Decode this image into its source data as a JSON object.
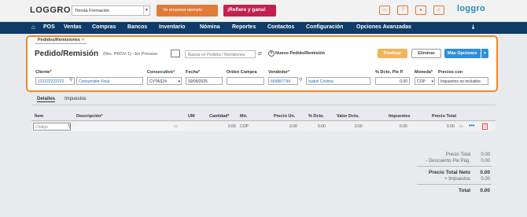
{
  "header": {
    "app_name": "LOGGRO",
    "company": "Tienda Formación",
    "example_button": "Ve empresa ejemplo",
    "refer_button": "¡Refiere y gana!",
    "brand_mark": "loggro"
  },
  "nav": {
    "items": [
      "POS",
      "Ventas",
      "Compras",
      "Bancos",
      "Inventario",
      "Nómina",
      "Reportes",
      "Contactos",
      "Configuración",
      "Opciones Avanzadas"
    ]
  },
  "panel": {
    "tab_label": "Pedidos/Remisiones",
    "title": "Pedido/Remisión",
    "subtitle": "(Nro. PROV-1) - En Proceso",
    "search_placeholder": "Buscar en Pedidos / Remisiones",
    "new_label": "Nuevo Pedido/Remisión",
    "finalize_label": "Finalizar",
    "delete_label": "Eliminar",
    "more_label": "Más Opciones",
    "fields": {
      "cliente_label": "Cliente",
      "cliente_id": "222222222222",
      "cliente_name": "Consumidor Final",
      "consecutivo_label": "Consecutivo",
      "consecutivo_value": "CVTAS24",
      "fecha_label": "Fecha",
      "fecha_value": "30/09/2025",
      "orden_label": "Orden Compra",
      "orden_value": "",
      "vendedor_label": "Vendedor",
      "vendedor_id": "669887794",
      "vendedor_name": "Isabel Cristina",
      "descuento_label": "% Dcto. Pie P.",
      "descuento_value": "0.00",
      "moneda_label": "Moneda",
      "moneda_value": "COP",
      "precios_label": "Precios con",
      "precios_value": "Impuestos no incluidos"
    }
  },
  "sub_tabs": [
    "Detalles",
    "Impuestos"
  ],
  "table": {
    "headers": [
      "Ítem",
      "Descripción",
      "UM",
      "Cantidad",
      "Mn.",
      "Precio Un.",
      "% Dcto.",
      "Valor Dcto.",
      "Impuestos",
      "Precio Total"
    ],
    "row": {
      "code_placeholder": "Código",
      "cantidad": "0.00",
      "moneda": "COP",
      "precio_un": "0.00",
      "dcto": "0.00",
      "valor_dcto": "0.00",
      "impuestos": "0.00",
      "precio_total": "0.00"
    }
  },
  "totals": {
    "precio_total_label": "Precio Total",
    "precio_total_value": "0.00",
    "descuento_label": "- Descuento Pie Pág.",
    "descuento_value": "0.00",
    "neto_label": "Precio Total Neto",
    "neto_value": "0.00",
    "impuestos_label": "+ Impuestos",
    "impuestos_value": "0.00",
    "total_label": "Total",
    "total_value": "0.00"
  },
  "colors": {
    "nav_bg": "#0e3b67",
    "accent_orange": "#f08a24",
    "primary_blue": "#2f8fd8",
    "refer_red": "#c2214e"
  }
}
